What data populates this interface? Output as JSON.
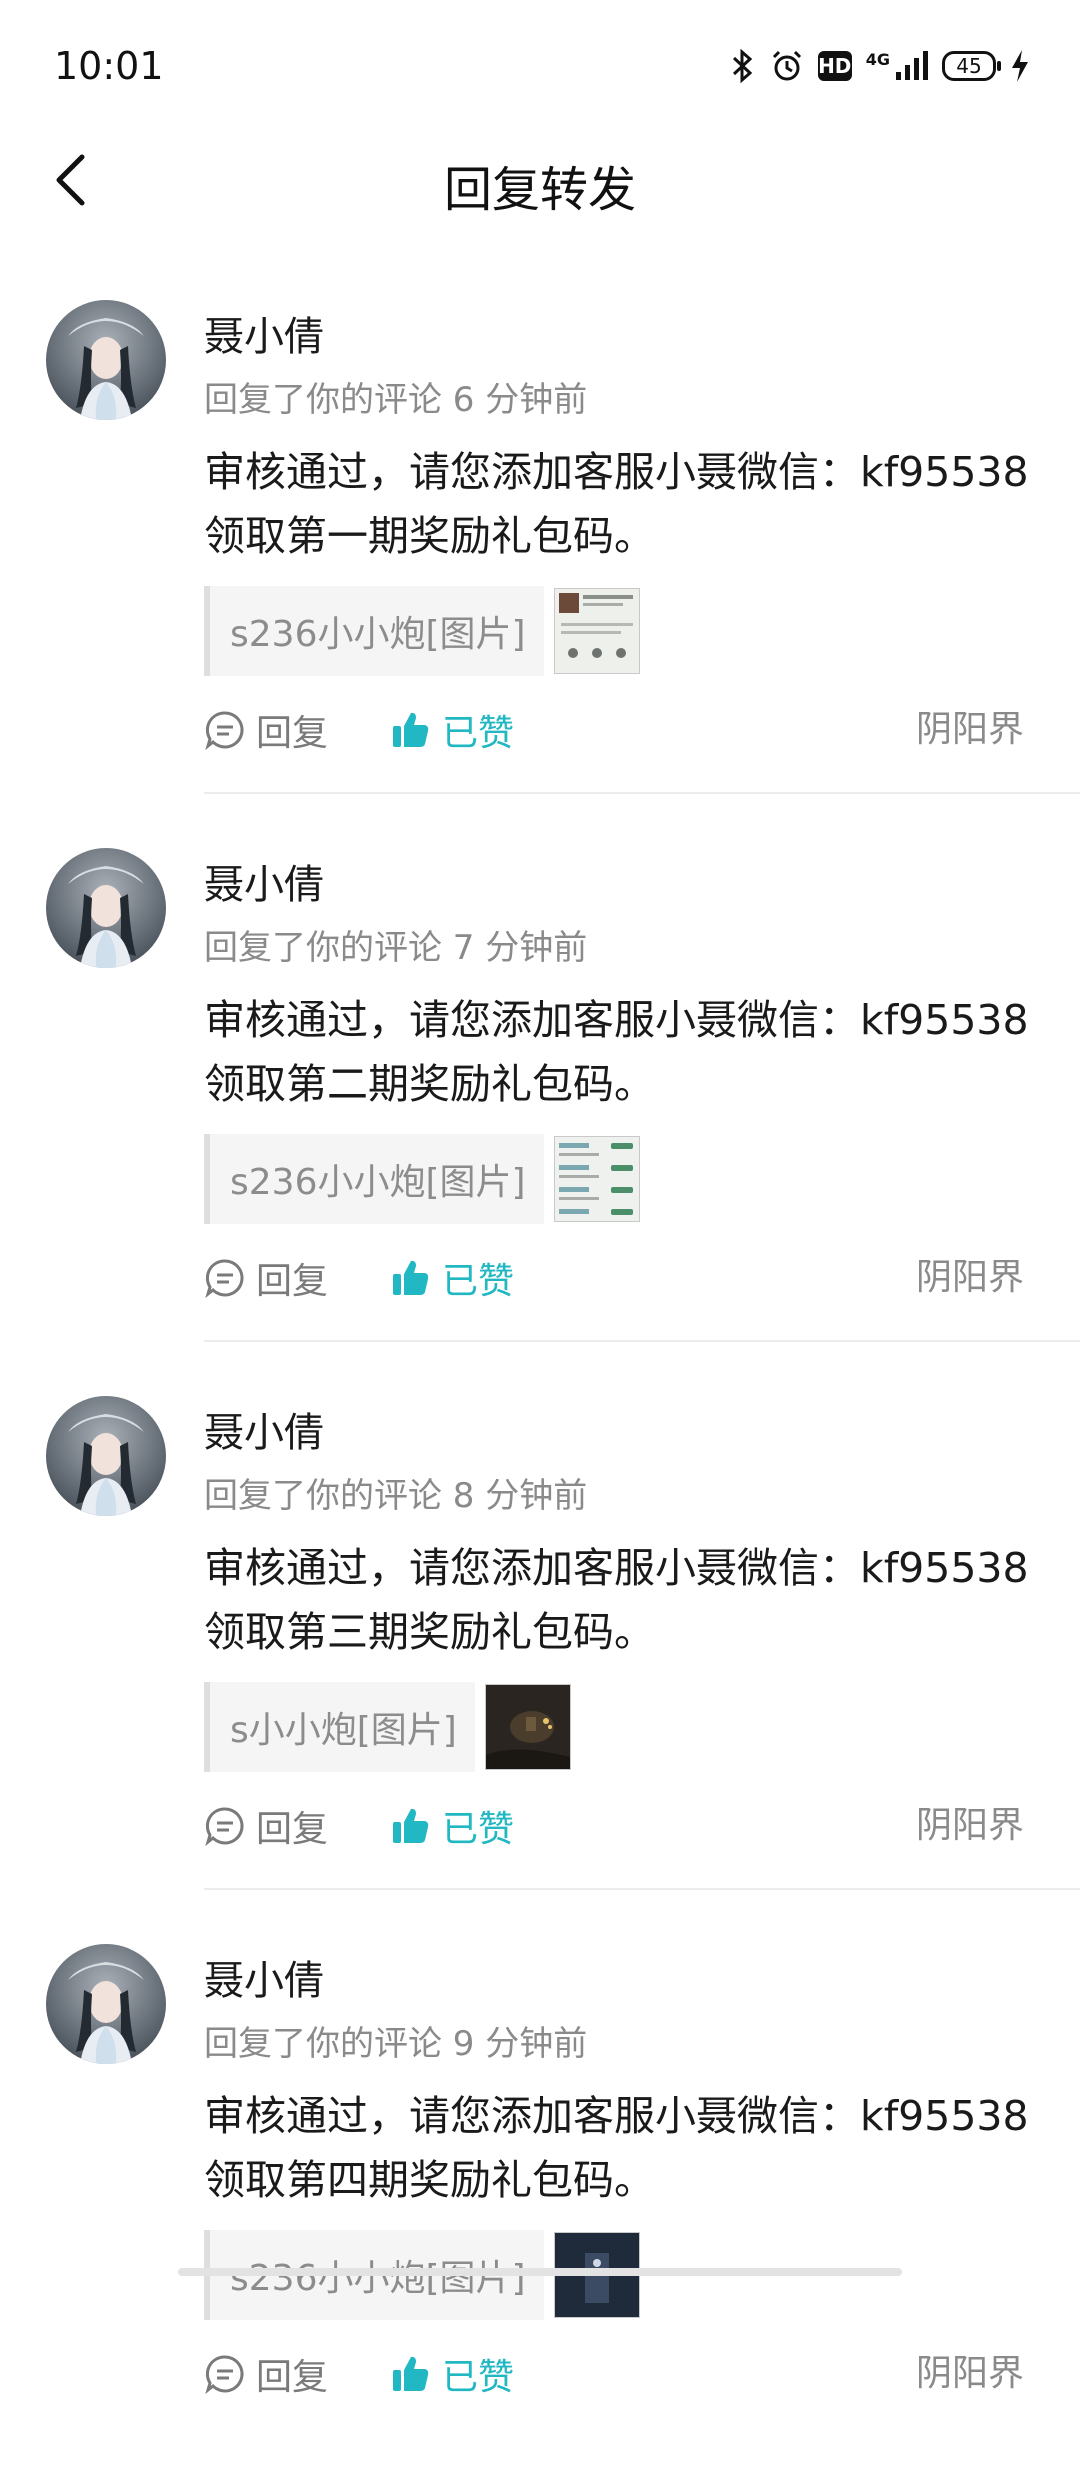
{
  "status_bar": {
    "time": "10:01",
    "icons": [
      "bluetooth-icon",
      "alarm-icon",
      "hd-icon",
      "4g-signal-icon",
      "battery-icon",
      "charging-icon"
    ],
    "hd": "HD",
    "network": "4G",
    "battery": "45"
  },
  "nav": {
    "title": "回复转发"
  },
  "colors": {
    "accent": "#22b8c3",
    "secondary_text": "#8a8a8a",
    "divider": "#ececec"
  },
  "items": [
    {
      "name": "聂小倩",
      "meta": "回复了你的评论 6 分钟前",
      "text": "审核通过，请您添加客服小聂微信：kf95538领取第一期奖励礼包码。",
      "quote": "s236小小炮[图片]",
      "reply_label": "回复",
      "like_label": "已赞",
      "game": "阴阳界"
    },
    {
      "name": "聂小倩",
      "meta": "回复了你的评论 7 分钟前",
      "text": "审核通过，请您添加客服小聂微信：kf95538领取第二期奖励礼包码。",
      "quote": "s236小小炮[图片]",
      "reply_label": "回复",
      "like_label": "已赞",
      "game": "阴阳界"
    },
    {
      "name": "聂小倩",
      "meta": "回复了你的评论 8 分钟前",
      "text": "审核通过，请您添加客服小聂微信：kf95538领取第三期奖励礼包码。",
      "quote": "s小小炮[图片]",
      "reply_label": "回复",
      "like_label": "已赞",
      "game": "阴阳界"
    },
    {
      "name": "聂小倩",
      "meta": "回复了你的评论 9 分钟前",
      "text": "审核通过，请您添加客服小聂微信：kf95538领取第四期奖励礼包码。",
      "quote": "s236小小炮[图片]",
      "reply_label": "回复",
      "like_label": "已赞",
      "game": "阴阳界"
    }
  ]
}
